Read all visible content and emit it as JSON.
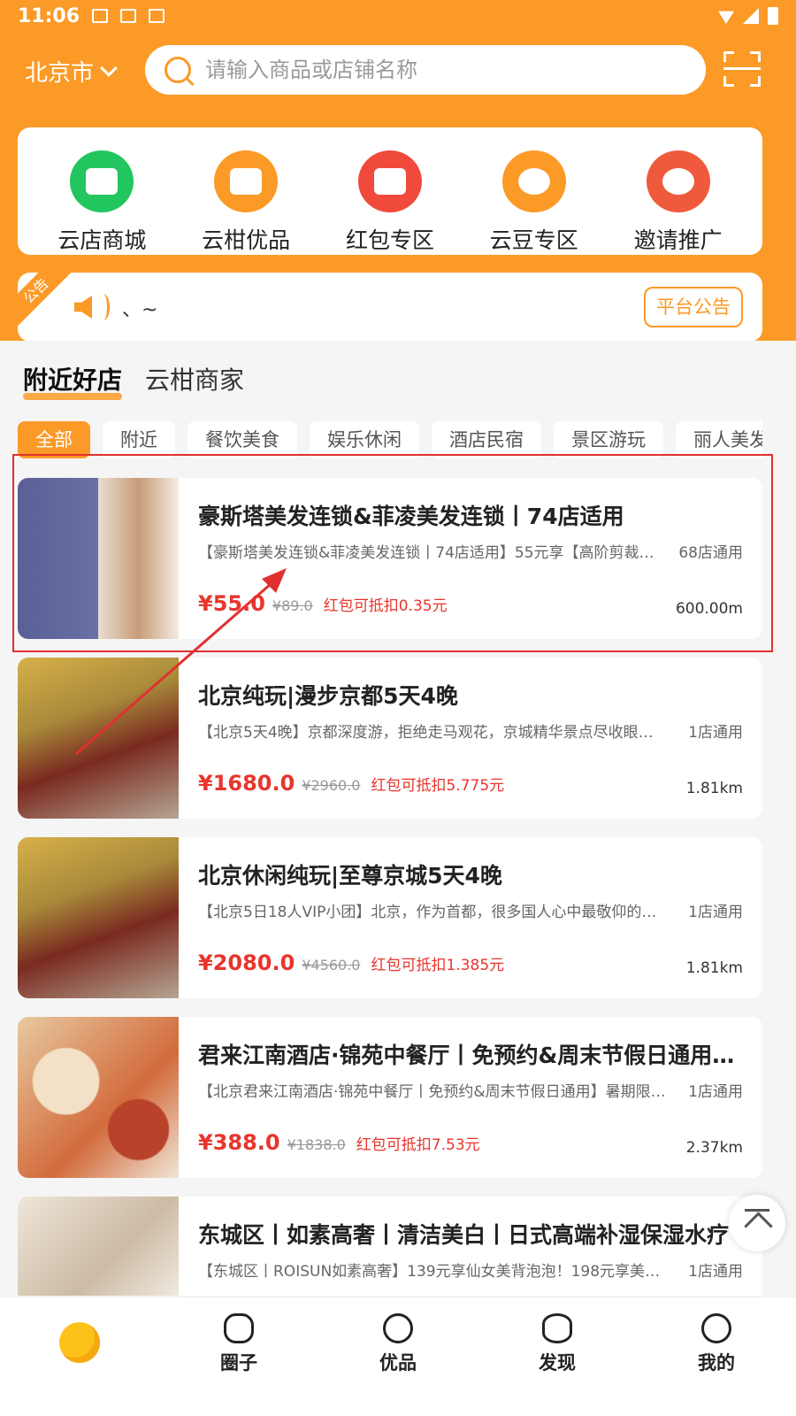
{
  "status_bar": {
    "time": "11:06"
  },
  "header": {
    "city": "北京市",
    "search_placeholder": "请输入商品或店铺名称"
  },
  "quick_entries": [
    {
      "label": "云店商城",
      "icon": "store-icon",
      "color": "#22c55e"
    },
    {
      "label": "云柑优品",
      "icon": "gift-bag-icon",
      "color": "#fb9a27"
    },
    {
      "label": "红包专区",
      "icon": "red-envelope-icon",
      "color": "#f04a3c"
    },
    {
      "label": "云豆专区",
      "icon": "bean-icon",
      "color": "#fb9a27"
    },
    {
      "label": "邀请推广",
      "icon": "badge-icon",
      "color": "#f05a3c"
    }
  ],
  "notice": {
    "tag": "公告",
    "text": "、~",
    "button": "平台公告"
  },
  "main_tabs": [
    {
      "label": "附近好店",
      "active": true
    },
    {
      "label": "云柑商家",
      "active": false
    }
  ],
  "filter_chips": [
    "全部",
    "附近",
    "餐饮美食",
    "娱乐休闲",
    "酒店民宿",
    "景区游玩",
    "丽人美发"
  ],
  "shops": [
    {
      "title": "豪斯塔美发连锁&菲凌美发连锁丨74店适用",
      "desc": "【豪斯塔美发连锁&菲凌美发连锁丨74店适用】55元享【高阶剪裁…",
      "stores": "68店通用",
      "price": "¥55.0",
      "original_price": "¥89.0",
      "red_packet": "红包可抵扣0.35元",
      "distance": "600.00m"
    },
    {
      "title": "北京纯玩|漫步京都5天4晚",
      "desc": "【北京5天4晚】京都深度游，拒绝走马观花，京城精华景点尽收眼底…",
      "stores": "1店通用",
      "price": "¥1680.0",
      "original_price": "¥2960.0",
      "red_packet": "红包可抵扣5.775元",
      "distance": "1.81km"
    },
    {
      "title": "北京休闲纯玩|至尊京城5天4晚",
      "desc": "【北京5日18人VIP小团】北京，作为首都，很多国人心中最敬仰的地…",
      "stores": "1店通用",
      "price": "¥2080.0",
      "original_price": "¥4560.0",
      "red_packet": "红包可抵扣1.385元",
      "distance": "1.81km"
    },
    {
      "title": "君来江南酒店·锦苑中餐厅丨免预约&周末节假日通用…",
      "desc": "【北京君来江南酒店·锦苑中餐厅丨免预约&周末节假日通用】暑期限…",
      "stores": "1店通用",
      "price": "¥388.0",
      "original_price": "¥1838.0",
      "red_packet": "红包可抵扣7.53元",
      "distance": "2.37km"
    },
    {
      "title": "东城区丨如素高奢丨清洁美白丨日式高端补湿保湿水疗",
      "desc": "【东城区丨ROISUN如素高奢】139元享仙女美背泡泡！198元享美人…",
      "stores": "1店通用",
      "price": "",
      "original_price": "",
      "red_packet": "",
      "distance": ""
    }
  ],
  "tab_bar": [
    {
      "label": "",
      "icon": "orange-home-icon"
    },
    {
      "label": "圈子",
      "icon": "chat-bubble-icon"
    },
    {
      "label": "优品",
      "icon": "camera-icon"
    },
    {
      "label": "发现",
      "icon": "planet-icon"
    },
    {
      "label": "我的",
      "icon": "user-icon"
    }
  ],
  "colors": {
    "brand": "#fb9a27",
    "price": "#e8352c"
  }
}
